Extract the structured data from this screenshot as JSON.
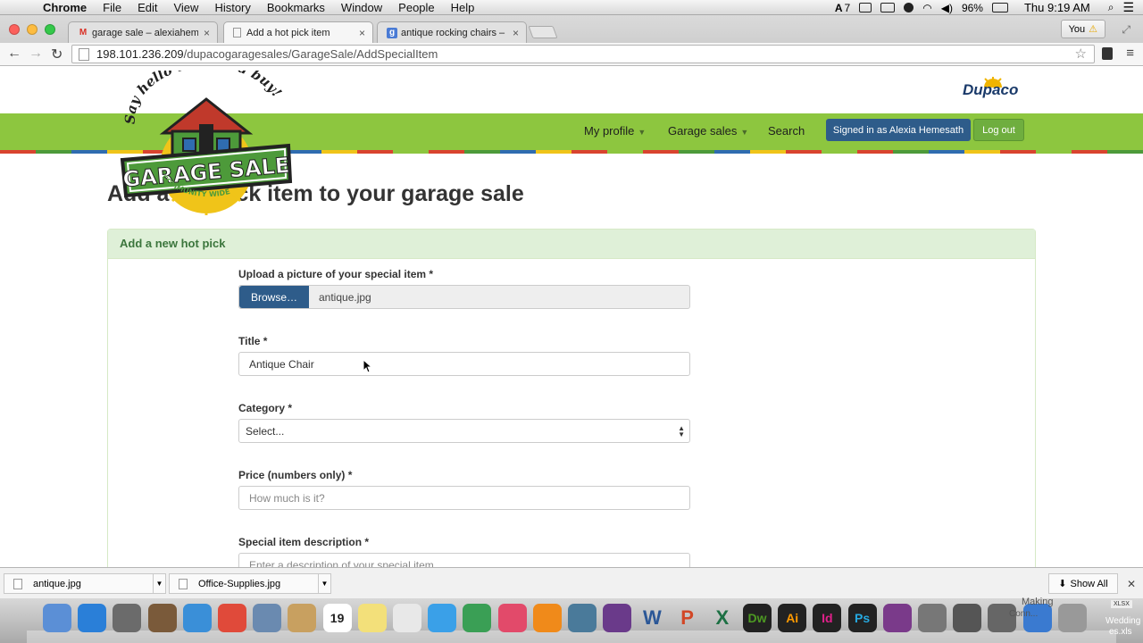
{
  "menubar": {
    "items": [
      "Chrome",
      "File",
      "Edit",
      "View",
      "History",
      "Bookmarks",
      "Window",
      "People",
      "Help"
    ],
    "status": {
      "battery": "96%",
      "clock": "Thu 9:19 AM",
      "adobe_count": "7"
    }
  },
  "tabs": [
    {
      "label": "garage sale – alexiahemes",
      "icon": "gmail-icon"
    },
    {
      "label": "Add a hot pick item",
      "icon": "page-icon"
    },
    {
      "label": "antique rocking chairs – G",
      "icon": "google-icon"
    }
  ],
  "profile": {
    "label": "You"
  },
  "omnibox": {
    "host": "198.101.236.209",
    "path": "/dupacogaragesales/GarageSale/AddSpecialItem"
  },
  "site": {
    "logo_text_top": "Say hello to a good buy!",
    "logo_text_main": "GARAGE SALE",
    "logo_text_bottom": "COMMUNITY WIDE",
    "brand": "Dupaco",
    "nav": {
      "my_profile": "My profile",
      "garage_sales": "Garage sales",
      "search": "Search"
    },
    "signed_in": "Signed in as Alexia Hemesath",
    "logout": "Log out"
  },
  "page": {
    "title": "Add a hot pick item to your garage sale",
    "panel_title": "Add a new hot pick",
    "upload_label": "Upload a picture of your special item *",
    "browse_label": "Browse…",
    "file_name": "antique.jpg",
    "title_label": "Title *",
    "title_value": "Antique Chair",
    "category_label": "Category *",
    "category_value": "Select...",
    "price_label": "Price (numbers only) *",
    "price_placeholder": "How much is it?",
    "desc_label": "Special item description *",
    "desc_placeholder": "Enter a description of your special item"
  },
  "downloads": {
    "items": [
      "antique.jpg",
      "Office-Supplies.jpg"
    ],
    "show_all": "Show All"
  },
  "dock": {
    "icons": [
      "finder-icon",
      "app-store-icon",
      "rocket-icon",
      "photo-booth-icon",
      "safari-icon",
      "chrome-icon",
      "preview-icon",
      "contacts-icon",
      "calendar-icon",
      "notes-icon",
      "reminders-icon",
      "messages-icon",
      "facetime-icon",
      "itunes-icon",
      "ibooks-icon",
      "iphoto-icon",
      "imovie-icon",
      "word-icon",
      "powerpoint-icon",
      "excel-icon",
      "dreamweaver-icon",
      "illustrator-icon",
      "indesign-icon",
      "photoshop-icon",
      "finalcut-icon",
      "system-prefs-icon",
      "display-icon",
      "display2-icon",
      "folder-icon",
      "trash-icon"
    ],
    "app_labels": {
      "word": "W",
      "ppt": "P",
      "excel": "X",
      "dw": "Dw",
      "ai": "Ai",
      "id": "Id",
      "ps": "Ps",
      "cal_day": "19"
    },
    "side_labels": {
      "making": "Making",
      "conn": "Conn...",
      "wedding": "Wedding",
      "xlsx": "XLSX",
      "file": "es.xls"
    }
  }
}
